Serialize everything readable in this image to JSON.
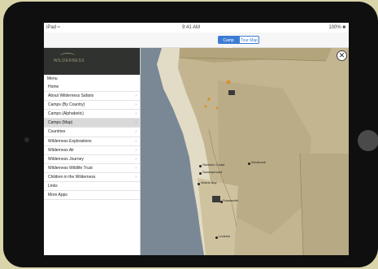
{
  "status": {
    "left": "iPad ≈",
    "time": "9:41 AM",
    "right": "100% ■"
  },
  "toggle": {
    "option_a": "Camp Map",
    "option_b": "Tour Map"
  },
  "brand": {
    "logo_text": "WILDERNESS"
  },
  "menu": {
    "header": "Menu",
    "items": [
      {
        "label": "Home",
        "chevron": ""
      },
      {
        "label": "About Wilderness Safaris",
        "chevron": "›"
      },
      {
        "label": "Camps (By Country)",
        "chevron": "›"
      },
      {
        "label": "Camps (Alphabetic)",
        "chevron": "›"
      },
      {
        "label": "Camps (Map)",
        "chevron": "›"
      },
      {
        "label": "Countries",
        "chevron": "›"
      },
      {
        "label": "Wilderness Explorations",
        "chevron": "›"
      },
      {
        "label": "Wilderness Air",
        "chevron": "›"
      },
      {
        "label": "Wilderness Journey",
        "chevron": "›"
      },
      {
        "label": "Wilderness Wildlife Trust",
        "chevron": "›"
      },
      {
        "label": "Children in the Wilderness",
        "chevron": "›"
      },
      {
        "label": "Links",
        "chevron": ""
      },
      {
        "label": "More Apps",
        "chevron": ""
      }
    ],
    "active_index": 4
  },
  "map": {
    "close_glyph": "✕",
    "labels": [
      {
        "text": "Skeleton Coast"
      },
      {
        "text": "Swakopmund"
      },
      {
        "text": "Windhoek"
      },
      {
        "text": "Walvis Bay"
      },
      {
        "text": "Sossusvlei"
      },
      {
        "text": "Lüderitz"
      }
    ],
    "colors": {
      "land": "#c2b590",
      "ocean": "#7a8896",
      "coast": "#e2dcc6",
      "marker_orange": "#d8932a"
    }
  }
}
